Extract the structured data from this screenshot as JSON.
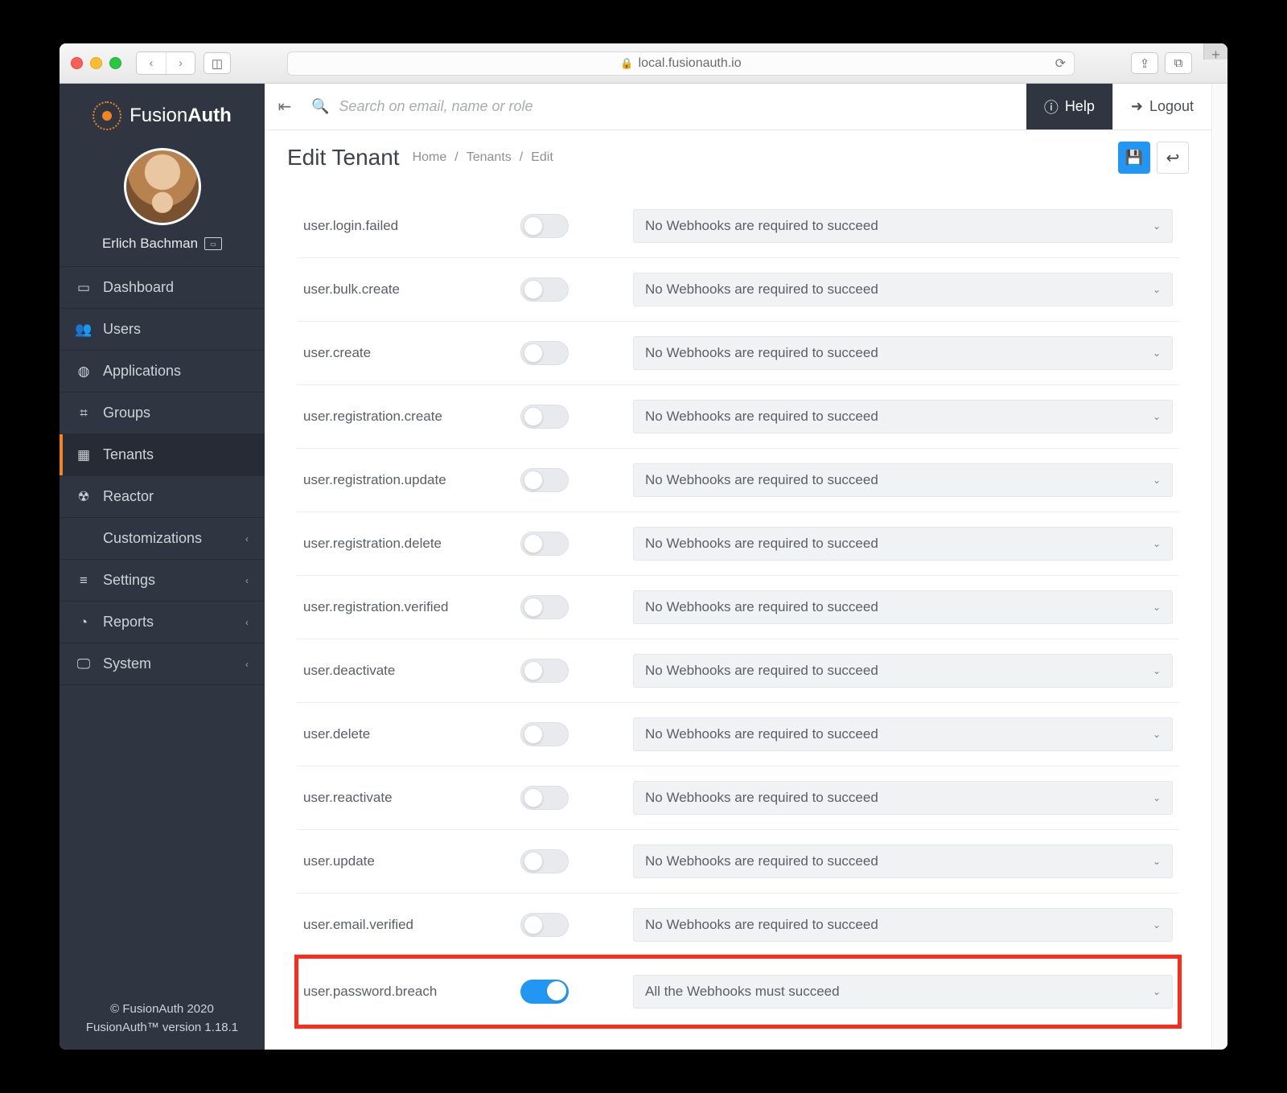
{
  "browser": {
    "url": "local.fusionauth.io"
  },
  "brand": {
    "name_a": "Fusion",
    "name_b": "Auth"
  },
  "user": {
    "name": "Erlich Bachman"
  },
  "sidebar": {
    "items": [
      {
        "label": "Dashboard",
        "icon": "▭"
      },
      {
        "label": "Users",
        "icon": "👥"
      },
      {
        "label": "Applications",
        "icon": "◍"
      },
      {
        "label": "Groups",
        "icon": "⌗"
      },
      {
        "label": "Tenants",
        "icon": "▦",
        "active": true
      },
      {
        "label": "Reactor",
        "icon": "☢"
      },
      {
        "label": "Customizations",
        "icon": "</>",
        "caret": true
      },
      {
        "label": "Settings",
        "icon": "≡",
        "caret": true
      },
      {
        "label": "Reports",
        "icon": "◔",
        "caret": true
      },
      {
        "label": "System",
        "icon": "🖵",
        "caret": true
      }
    ]
  },
  "footer": {
    "copyright": "© FusionAuth 2020",
    "version": "FusionAuth™ version 1.18.1"
  },
  "topbar": {
    "search_placeholder": "Search on email, name or role",
    "help": "Help",
    "logout": "Logout"
  },
  "page": {
    "title": "Edit Tenant",
    "breadcrumb": [
      "Home",
      "Tenants",
      "Edit"
    ]
  },
  "select_default": "No Webhooks are required to succeed",
  "select_all": "All the Webhooks must succeed",
  "events": [
    {
      "name": "user.login.failed",
      "on": false,
      "sel": "default"
    },
    {
      "name": "user.bulk.create",
      "on": false,
      "sel": "default"
    },
    {
      "name": "user.create",
      "on": false,
      "sel": "default"
    },
    {
      "name": "user.registration.create",
      "on": false,
      "sel": "default"
    },
    {
      "name": "user.registration.update",
      "on": false,
      "sel": "default"
    },
    {
      "name": "user.registration.delete",
      "on": false,
      "sel": "default"
    },
    {
      "name": "user.registration.verified",
      "on": false,
      "sel": "default"
    },
    {
      "name": "user.deactivate",
      "on": false,
      "sel": "default"
    },
    {
      "name": "user.delete",
      "on": false,
      "sel": "default"
    },
    {
      "name": "user.reactivate",
      "on": false,
      "sel": "default"
    },
    {
      "name": "user.update",
      "on": false,
      "sel": "default"
    },
    {
      "name": "user.email.verified",
      "on": false,
      "sel": "default"
    },
    {
      "name": "user.password.breach",
      "on": true,
      "sel": "all",
      "highlight": true
    }
  ]
}
